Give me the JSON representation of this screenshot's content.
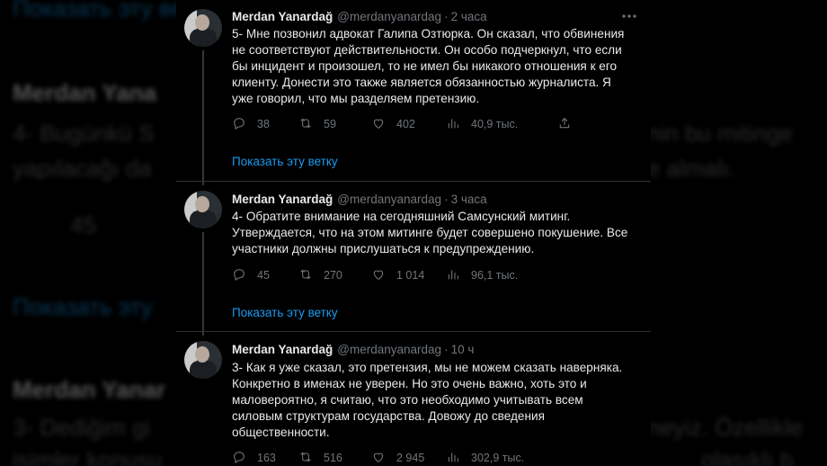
{
  "background": {
    "texts": [
      {
        "text": "Показать эту ветку",
        "style": "link"
      },
      {
        "text": "Merdan Yana",
        "style": "bold"
      },
      {
        "text": "4- Bugünkü S",
        "style": "gray"
      },
      {
        "text": "yapılacağı da",
        "style": "gray"
      },
      {
        "text": "nin bu mitinge",
        "style": "gray"
      },
      {
        "text": "e almalı.",
        "style": "gray"
      },
      {
        "text": "45",
        "style": "gray"
      },
      {
        "text": "Показать эту",
        "style": "link"
      },
      {
        "text": "Merdan Yanar",
        "style": "bold"
      },
      {
        "text": "3- Dediğim gi",
        "style": "gray"
      },
      {
        "text": "neyiz. Özellikle",
        "style": "gray"
      },
      {
        "text": "isimler konusu",
        "style": "gray"
      },
      {
        "text": "olasıklı b",
        "style": "gray"
      }
    ]
  },
  "tweets": [
    {
      "author": "Merdan Yanardağ",
      "handle": "@merdanyanardag",
      "separator": "·",
      "time": "2 часа",
      "text": "5- Мне позвонил адвокат Галипа Озтюрка. Он сказал, что обвинения\nне соответствуют действительности. Он особо подчеркнул, что если\nбы инцидент и произошел, то не имел бы никакого отношения к его\nклиенту. Донести это также является обязанностью журналиста. Я\nуже говорил, что мы разделяем претензию.",
      "replies": "38",
      "retweets": "59",
      "likes": "402",
      "views": "40,9 тыс.",
      "show_thread": "Показать эту ветку"
    },
    {
      "author": "Merdan Yanardağ",
      "handle": "@merdanyanardag",
      "separator": "·",
      "time": "3 часа",
      "text": "4- Обратите внимание на сегодняшний Самсунский митинг.\nУтверждается, что на этом митинге будет совершено покушение. Все\nучастники должны прислушаться к предупреждению.",
      "replies": "45",
      "retweets": "270",
      "likes": "1 014",
      "views": "96,1 тыс.",
      "show_thread": "Показать эту ветку"
    },
    {
      "author": "Merdan Yanardağ",
      "handle": "@merdanyanardag",
      "separator": "·",
      "time": "10 ч",
      "text": "3- Как я уже сказал, это претензия, мы не можем сказать наверняка.\nКонкретно в именах не уверен. Но это очень важно, хоть это и\nмаловероятно, я считаю, что это необходимо учитывать всем\nсиловым структурам государства. Довожу до сведения\nобщественности.",
      "replies": "163",
      "retweets": "516",
      "likes": "2 945",
      "views": "302,9 тыс."
    }
  ],
  "colors": {
    "background": "#000000",
    "text": "#e7e9ea",
    "secondary": "#71767b",
    "link": "#1d9bf0",
    "divider": "#2f3336"
  },
  "icons": [
    "more-icon",
    "reply-icon",
    "retweet-icon",
    "like-icon",
    "views-icon",
    "share-icon"
  ]
}
